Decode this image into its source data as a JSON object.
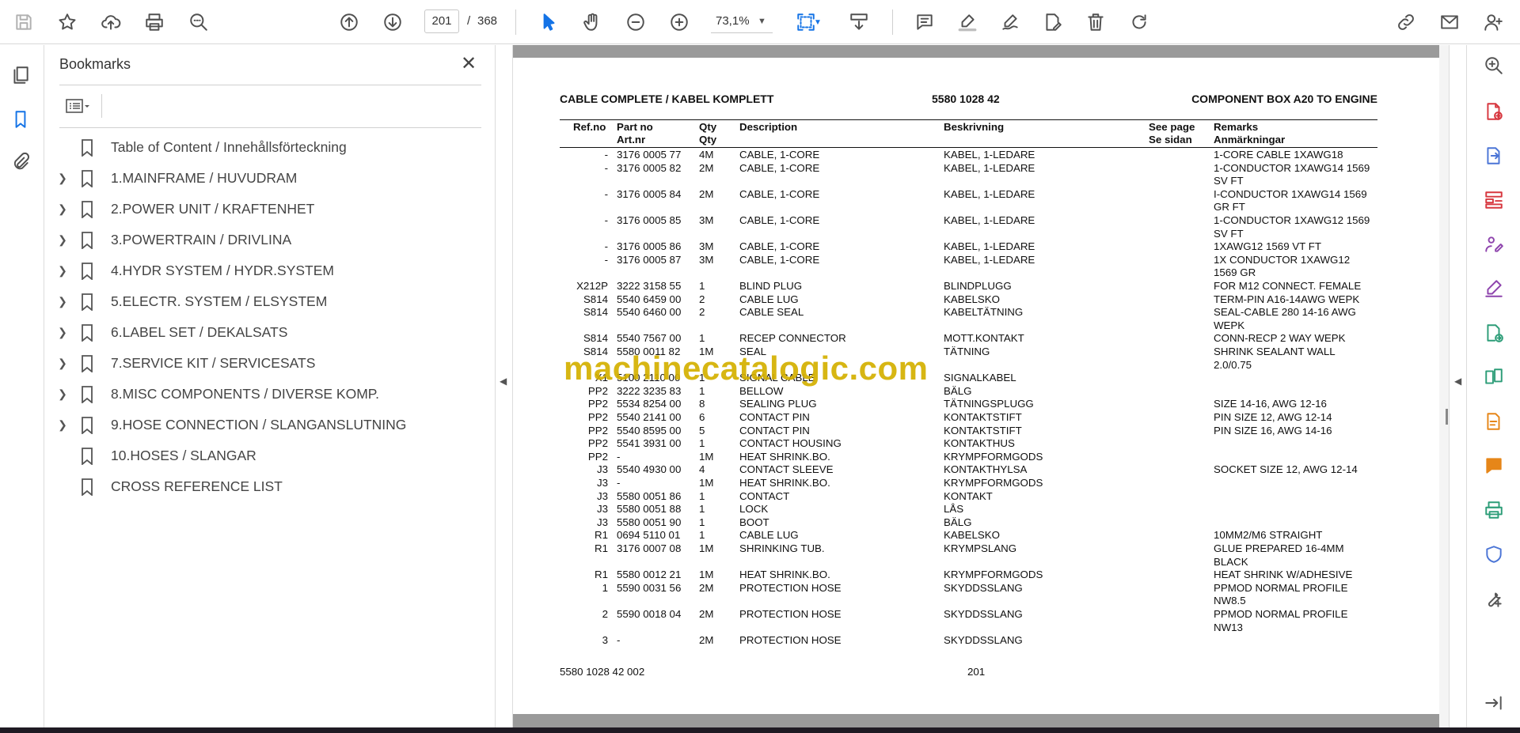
{
  "toolbar": {
    "page_current": "201",
    "page_separator": "/",
    "page_total": "368",
    "zoom": "73,1%"
  },
  "sidebar": {
    "title": "Bookmarks",
    "close_glyph": "✕",
    "items": [
      {
        "label": "Table of Content / Innehållsförteckning",
        "expandable": false
      },
      {
        "label": "1.MAINFRAME / HUVUDRAM",
        "expandable": true
      },
      {
        "label": "2.POWER UNIT / KRAFTENHET",
        "expandable": true
      },
      {
        "label": "3.POWERTRAIN / DRIVLINA",
        "expandable": true
      },
      {
        "label": "4.HYDR SYSTEM / HYDR.SYSTEM",
        "expandable": true
      },
      {
        "label": "5.ELECTR. SYSTEM / ELSYSTEM",
        "expandable": true
      },
      {
        "label": "6.LABEL SET / DEKALSATS",
        "expandable": true
      },
      {
        "label": "7.SERVICE KIT / SERVICESATS",
        "expandable": true
      },
      {
        "label": "8.MISC COMPONENTS / DIVERSE KOMP.",
        "expandable": true
      },
      {
        "label": "9.HOSE CONNECTION / SLANGANSLUTNING",
        "expandable": true
      },
      {
        "label": "10.HOSES / SLANGAR",
        "expandable": false
      },
      {
        "label": "CROSS REFERENCE LIST",
        "expandable": false
      }
    ]
  },
  "document": {
    "title_left": "CABLE COMPLETE / KABEL KOMPLETT",
    "title_mid": "5580 1028 42",
    "title_right": "COMPONENT BOX A20 TO ENGINE",
    "headers": {
      "refno": "Ref.no",
      "partno1": "Part no",
      "partno2": "Art.nr",
      "qty1": "Qty",
      "qty2": "Qty",
      "desc": "Description",
      "beskr": "Beskrivning",
      "see1": "See page",
      "see2": "Se sidan",
      "rem1": "Remarks",
      "rem2": "Anmärkningar"
    },
    "rows": [
      {
        "ref": "-",
        "part": "3176 0005 77",
        "qty": "4M",
        "desc": "CABLE, 1-CORE",
        "beskr": "KABEL, 1-LEDARE",
        "rem": [
          "1-CORE CABLE 1XAWG18"
        ]
      },
      {
        "ref": "-",
        "part": "3176 0005 82",
        "qty": "2M",
        "desc": "CABLE, 1-CORE",
        "beskr": "KABEL, 1-LEDARE",
        "rem": [
          "1-CONDUCTOR 1XAWG14 1569",
          "SV FT"
        ]
      },
      {
        "ref": "-",
        "part": "3176 0005 84",
        "qty": "2M",
        "desc": "CABLE, 1-CORE",
        "beskr": "KABEL, 1-LEDARE",
        "rem": [
          "I-CONDUCTOR 1XAWG14 1569",
          "GR FT"
        ]
      },
      {
        "ref": "-",
        "part": "3176 0005 85",
        "qty": "3M",
        "desc": "CABLE, 1-CORE",
        "beskr": "KABEL, 1-LEDARE",
        "rem": [
          "1-CONDUCTOR 1XAWG12 1569",
          "SV FT"
        ]
      },
      {
        "ref": "-",
        "part": "3176 0005 86",
        "qty": "3M",
        "desc": "CABLE, 1-CORE",
        "beskr": "KABEL, 1-LEDARE",
        "rem": [
          "1XAWG12 1569 VT FT"
        ]
      },
      {
        "ref": "-",
        "part": "3176 0005 87",
        "qty": "3M",
        "desc": "CABLE, 1-CORE",
        "beskr": "KABEL, 1-LEDARE",
        "rem": [
          "1X CONDUCTOR 1XAWG12",
          "1569 GR"
        ]
      },
      {
        "ref": "X212P",
        "part": "3222 3158 55",
        "qty": "1",
        "desc": "BLIND PLUG",
        "beskr": "BLINDPLUGG",
        "rem": [
          "FOR M12 CONNECT. FEMALE"
        ]
      },
      {
        "ref": "S814",
        "part": "5540 6459 00",
        "qty": "2",
        "desc": "CABLE LUG",
        "beskr": "KABELSKO",
        "rem": [
          "TERM-PIN A16-14AWG WEPK"
        ]
      },
      {
        "ref": "S814",
        "part": "5540 6460 00",
        "qty": "2",
        "desc": "CABLE SEAL",
        "beskr": "KABELTÄTNING",
        "rem": [
          "SEAL-CABLE 280 14-16 AWG",
          "WEPK"
        ]
      },
      {
        "ref": "S814",
        "part": "5540 7567 00",
        "qty": "1",
        "desc": "RECEP CONNECTOR",
        "beskr": "MOTT.KONTAKT",
        "rem": [
          "CONN-RECP 2 WAY WEPK"
        ]
      },
      {
        "ref": "S814",
        "part": "5580 0011 82",
        "qty": "1M",
        "desc": "SEAL",
        "beskr": "TÄTNING",
        "rem": [
          "SHRINK SEALANT WALL",
          "2.0/0.75"
        ]
      },
      {
        "ref": "X1",
        "part": "5100 2110 00",
        "qty": "1",
        "desc": "SIGNAL CABLE",
        "beskr": "SIGNALKABEL",
        "rem": []
      },
      {
        "ref": "PP2",
        "part": "3222 3235 83",
        "qty": "1",
        "desc": "BELLOW",
        "beskr": "BÄLG",
        "rem": []
      },
      {
        "ref": "PP2",
        "part": "5534 8254 00",
        "qty": "8",
        "desc": "SEALING PLUG",
        "beskr": "TÄTNINGSPLUGG",
        "rem": [
          "SIZE 14-16, AWG 12-16"
        ]
      },
      {
        "ref": "PP2",
        "part": "5540 2141 00",
        "qty": "6",
        "desc": "CONTACT PIN",
        "beskr": "KONTAKTSTIFT",
        "rem": [
          "PIN SIZE 12, AWG 12-14"
        ]
      },
      {
        "ref": "PP2",
        "part": "5540 8595 00",
        "qty": "5",
        "desc": "CONTACT PIN",
        "beskr": "KONTAKTSTIFT",
        "rem": [
          "PIN SIZE 16, AWG 14-16"
        ]
      },
      {
        "ref": "PP2",
        "part": "5541 3931 00",
        "qty": "1",
        "desc": "CONTACT HOUSING",
        "beskr": "KONTAKTHUS",
        "rem": []
      },
      {
        "ref": "PP2",
        "part": "-",
        "qty": "1M",
        "desc": "HEAT SHRINK.BO.",
        "beskr": "KRYMPFORMGODS",
        "rem": []
      },
      {
        "ref": "J3",
        "part": "5540 4930 00",
        "qty": "4",
        "desc": "CONTACT SLEEVE",
        "beskr": "KONTAKTHYLSA",
        "rem": [
          "SOCKET SIZE 12, AWG 12-14"
        ]
      },
      {
        "ref": "J3",
        "part": "-",
        "qty": "1M",
        "desc": "HEAT SHRINK.BO.",
        "beskr": "KRYMPFORMGODS",
        "rem": []
      },
      {
        "ref": "J3",
        "part": "5580 0051 86",
        "qty": "1",
        "desc": "CONTACT",
        "beskr": "KONTAKT",
        "rem": []
      },
      {
        "ref": "J3",
        "part": "5580 0051 88",
        "qty": "1",
        "desc": "LOCK",
        "beskr": "LÅS",
        "rem": []
      },
      {
        "ref": "J3",
        "part": "5580 0051 90",
        "qty": "1",
        "desc": "BOOT",
        "beskr": "BÄLG",
        "rem": []
      },
      {
        "ref": "R1",
        "part": "0694 5110 01",
        "qty": "1",
        "desc": "CABLE LUG",
        "beskr": "KABELSKO",
        "rem": [
          "10MM2/M6 STRAIGHT"
        ]
      },
      {
        "ref": "R1",
        "part": "3176 0007 08",
        "qty": "1M",
        "desc": "SHRINKING TUB.",
        "beskr": "KRYMPSLANG",
        "rem": [
          "GLUE PREPARED 16-4MM",
          "BLACK"
        ]
      },
      {
        "ref": "R1",
        "part": "5580 0012 21",
        "qty": "1M",
        "desc": "HEAT SHRINK.BO.",
        "beskr": "KRYMPFORMGODS",
        "rem": [
          "HEAT SHRINK W/ADHESIVE"
        ]
      },
      {
        "ref": "1",
        "part": "5590 0031 56",
        "qty": "2M",
        "desc": "PROTECTION HOSE",
        "beskr": "SKYDDSSLANG",
        "rem": [
          "PPMOD NORMAL PROFILE",
          "NW8.5"
        ]
      },
      {
        "ref": "2",
        "part": "5590 0018 04",
        "qty": "2M",
        "desc": "PROTECTION HOSE",
        "beskr": "SKYDDSSLANG",
        "rem": [
          "PPMOD NORMAL PROFILE",
          "NW13"
        ]
      },
      {
        "ref": "3",
        "part": "-",
        "qty": "2M",
        "desc": "PROTECTION HOSE",
        "beskr": "SKYDDSSLANG",
        "rem": []
      }
    ],
    "footer_left": "5580 1028 42 002",
    "footer_page": "201",
    "watermark": "machinecatalogic.com"
  },
  "colors": {
    "accent": "#1473e6",
    "right_rail_red": "#d7373f",
    "right_rail_purple": "#8e44ad",
    "right_rail_green": "#2d9d78",
    "right_rail_orange": "#e68619",
    "right_rail_blue": "#4b75d6",
    "watermark": "#d4b000"
  }
}
